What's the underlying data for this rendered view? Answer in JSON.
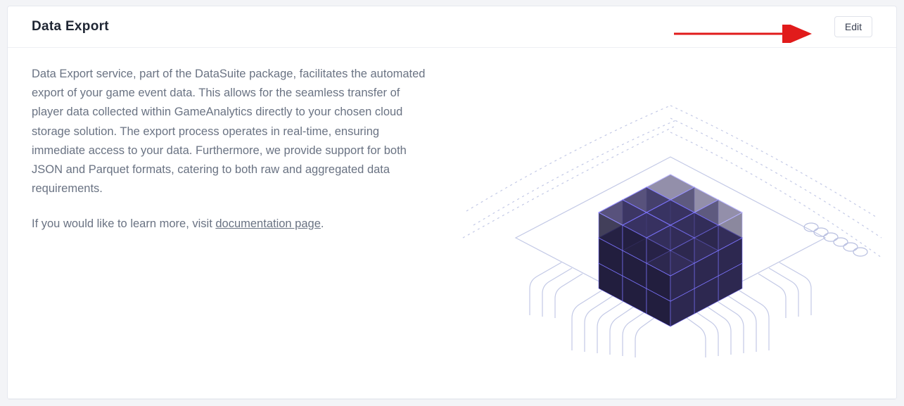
{
  "header": {
    "title": "Data Export",
    "edit_label": "Edit"
  },
  "body": {
    "paragraph1": "Data Export service, part of the DataSuite package, facilitates the automated export of your game event data. This allows for the seamless transfer of player data collected within GameAnalytics directly to your chosen cloud storage solution. The export process operates in real-time, ensuring immediate access to your data. Furthermore, we provide support for both JSON and Parquet formats, catering to both raw and aggregated data requirements.",
    "paragraph2_prefix": "If you would like to learn more, visit ",
    "doc_link_text": "documentation page",
    "paragraph2_suffix": "."
  },
  "colors": {
    "cube_fill": "#2b264e",
    "cube_edge": "#7d74ff",
    "circuit_line": "#bfc6e6",
    "arrow": "#e11b1b"
  }
}
